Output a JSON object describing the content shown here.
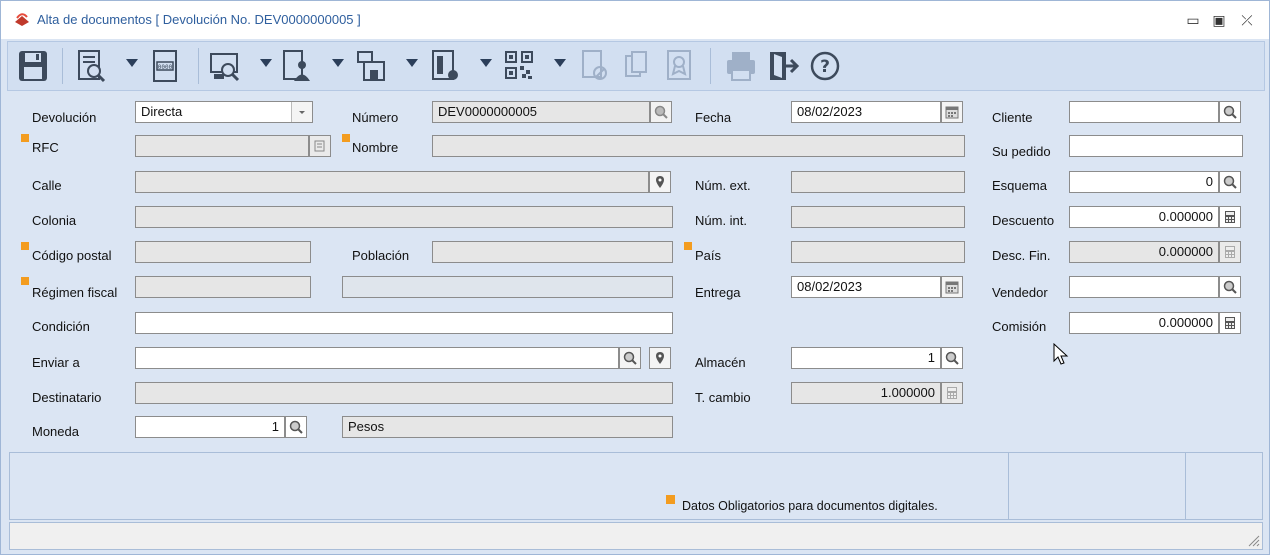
{
  "window": {
    "title": "Alta de documentos [ Devolución No. DEV0000000005 ]",
    "controls": {
      "minimize": "▭",
      "maximize": "▣",
      "close": "⤫"
    }
  },
  "toolbar": {
    "icons": [
      "save-icon",
      "search-document-icon",
      "numbering-icon",
      "preview-icon",
      "client-info-icon",
      "store-icon",
      "document-icon",
      "qr-code-icon",
      "cancel-document-icon",
      "copy-document-icon",
      "certificate-icon",
      "print-icon",
      "exit-icon",
      "help-icon"
    ]
  },
  "form": {
    "devolucion_label": "Devolución",
    "devolucion_value": "Directa",
    "numero_label": "Número",
    "numero_value": "DEV0000000005",
    "fecha_label": "Fecha",
    "fecha_value": "08/02/2023",
    "cliente_label": "Cliente",
    "cliente_value": "",
    "rfc_label": "RFC",
    "rfc_value": "",
    "nombre_label": "Nombre",
    "nombre_value": "",
    "su_pedido_label": "Su pedido",
    "su_pedido_value": "",
    "calle_label": "Calle",
    "num_ext_label": "Núm. ext.",
    "esquema_label": "Esquema",
    "esquema_value": "0",
    "colonia_label": "Colonia",
    "num_int_label": "Núm. int.",
    "descuento_label": "Descuento",
    "descuento_value": "0.000000",
    "codigo_postal_label": "Código postal",
    "poblacion_label": "Población",
    "pais_label": "País",
    "desc_fin_label": "Desc. Fin.",
    "desc_fin_value": "0.000000",
    "regimen_fiscal_label": "Régimen fiscal",
    "entrega_label": "Entrega",
    "entrega_value": "08/02/2023",
    "vendedor_label": "Vendedor",
    "vendedor_value": "",
    "condicion_label": "Condición",
    "comision_label": "Comisión",
    "comision_value": "0.000000",
    "enviar_a_label": "Enviar a",
    "almacen_label": "Almacén",
    "almacen_value": "1",
    "destinatario_label": "Destinatario",
    "t_cambio_label": "T. cambio",
    "t_cambio_value": "1.000000",
    "moneda_label": "Moneda",
    "moneda_value": "1",
    "moneda_name": "Pesos"
  },
  "footer": {
    "required_note": "Datos Obligatorios para documentos digitales."
  },
  "colors": {
    "required": "#f39c1f",
    "title": "#2f5f9e",
    "panel": "#dbe5f3"
  }
}
